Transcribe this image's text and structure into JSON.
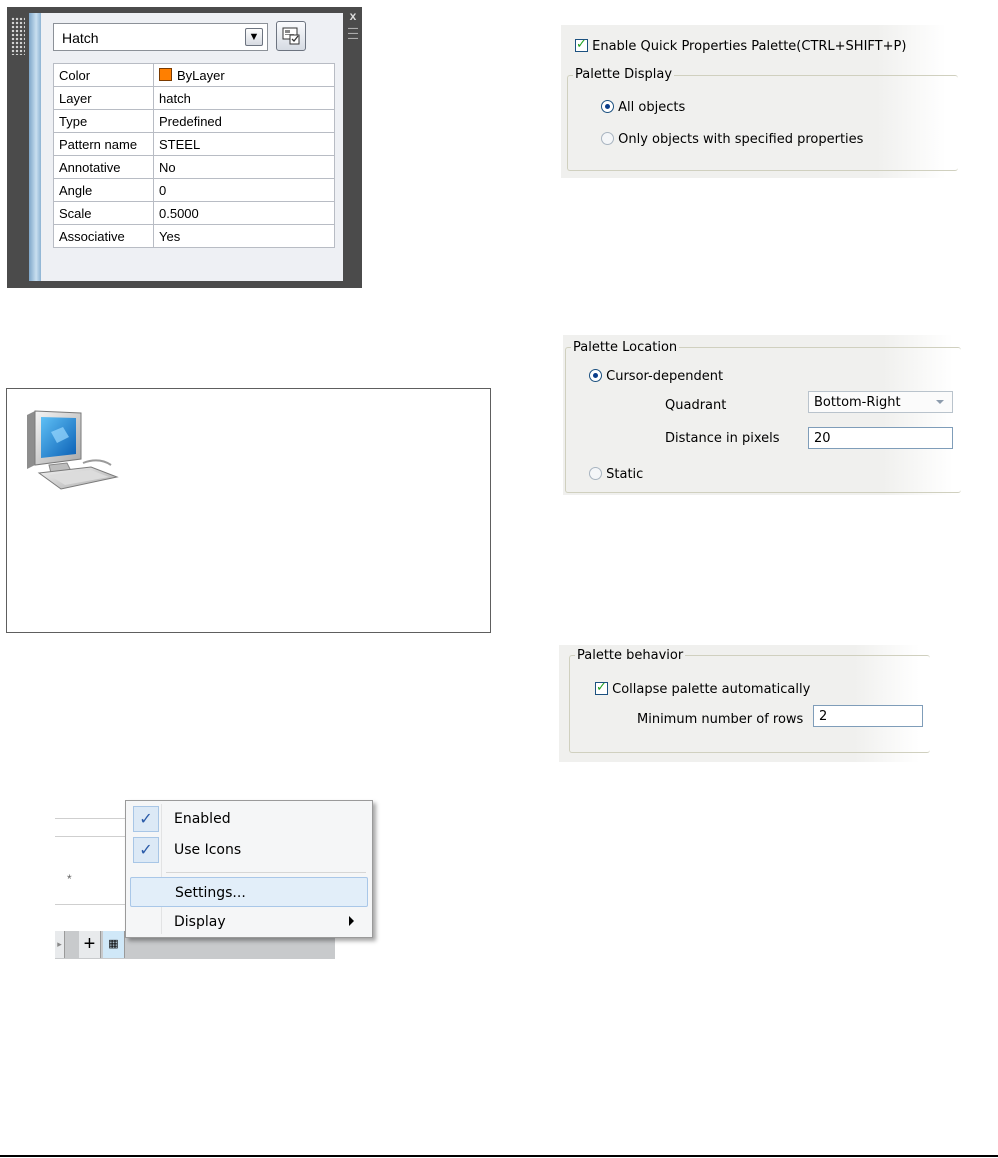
{
  "quick_properties": {
    "object_type": "Hatch",
    "dropdown_arrow": "chevron-down-icon",
    "select_objects_icon": "select-objects-icon",
    "close_glyph": "x",
    "properties": [
      {
        "name": "Color",
        "value": "ByLayer",
        "swatch": "#ff7f00"
      },
      {
        "name": "Layer",
        "value": "hatch"
      },
      {
        "name": "Type",
        "value": "Predefined"
      },
      {
        "name": "Pattern name",
        "value": "STEEL"
      },
      {
        "name": "Annotative",
        "value": "No"
      },
      {
        "name": "Angle",
        "value": "0"
      },
      {
        "name": "Scale",
        "value": "0.5000"
      },
      {
        "name": "Associative",
        "value": "Yes"
      }
    ]
  },
  "context_menu": {
    "items": [
      {
        "label": "Enabled",
        "checked": true
      },
      {
        "label": "Use Icons",
        "checked": true
      },
      {
        "label": "Settings...",
        "highlighted": true
      },
      {
        "label": "Display",
        "submenu": true
      }
    ],
    "background_text": "*"
  },
  "qp_settings": {
    "enable_label": "Enable Quick Properties Palette(CTRL+SHIFT+P)",
    "enable_checked": true,
    "display_group": "Palette Display",
    "all_objects": "All objects",
    "only_specified": "Only objects with specified properties"
  },
  "location": {
    "group": "Palette Location",
    "cursor_dependent": "Cursor-dependent",
    "quadrant_label": "Quadrant",
    "quadrant_value": "Bottom-Right",
    "distance_label": "Distance in pixels",
    "distance_value": "20",
    "static": "Static"
  },
  "behavior": {
    "group": "Palette behavior",
    "collapse_label": "Collapse palette automatically",
    "collapse_checked": true,
    "min_rows_label": "Minimum number of rows",
    "min_rows_value": "2"
  },
  "colors": {
    "palette_bg": "#4b4b4b",
    "highlight": "#e2eef9",
    "check_color": "#2a5aa8"
  }
}
